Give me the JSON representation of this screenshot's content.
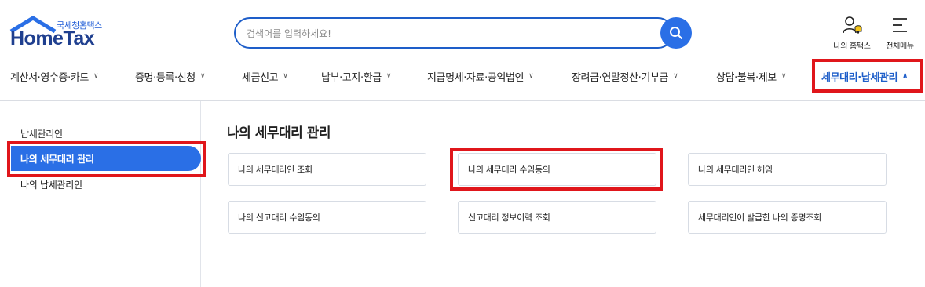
{
  "header": {
    "logo_korean": "국세청홈택스",
    "logo_english": "HomeTax",
    "search_placeholder": "검색어를 입력하세요!",
    "util": [
      {
        "label": "나의 홈택스",
        "icon": "user-bell-icon"
      },
      {
        "label": "전체메뉴",
        "icon": "hamburger-menu-icon"
      }
    ]
  },
  "nav": {
    "items": [
      {
        "label": "계산서·영수증·카드"
      },
      {
        "label": "증명·등록·신청"
      },
      {
        "label": "세금신고"
      },
      {
        "label": "납부·고지·환급"
      },
      {
        "label": "지급명세·자료·공익법인"
      },
      {
        "label": "장려금·연말정산·기부금"
      },
      {
        "label": "상담·불복·제보"
      },
      {
        "label": "세무대리·납세관리"
      }
    ],
    "active_index": 7
  },
  "sidebar": {
    "items": [
      {
        "label": "납세관리인"
      },
      {
        "label": "나의 세무대리 관리"
      },
      {
        "label": "나의 납세관리인"
      }
    ],
    "active_index": 1
  },
  "main": {
    "title": "나의 세무대리 관리",
    "cards": [
      {
        "label": "나의 세무대리인 조회"
      },
      {
        "label": "나의 세무대리 수임동의"
      },
      {
        "label": "나의 세무대리인 해임"
      },
      {
        "label": "나의 신고대리 수임동의"
      },
      {
        "label": "신고대리 정보이력 조회"
      },
      {
        "label": "세무대리인이 발급한 나의 증명조회"
      }
    ]
  },
  "colors": {
    "brand_blue": "#2a6fe6",
    "logo_navy": "#1f3f8f",
    "highlight_red": "#e0161b"
  }
}
